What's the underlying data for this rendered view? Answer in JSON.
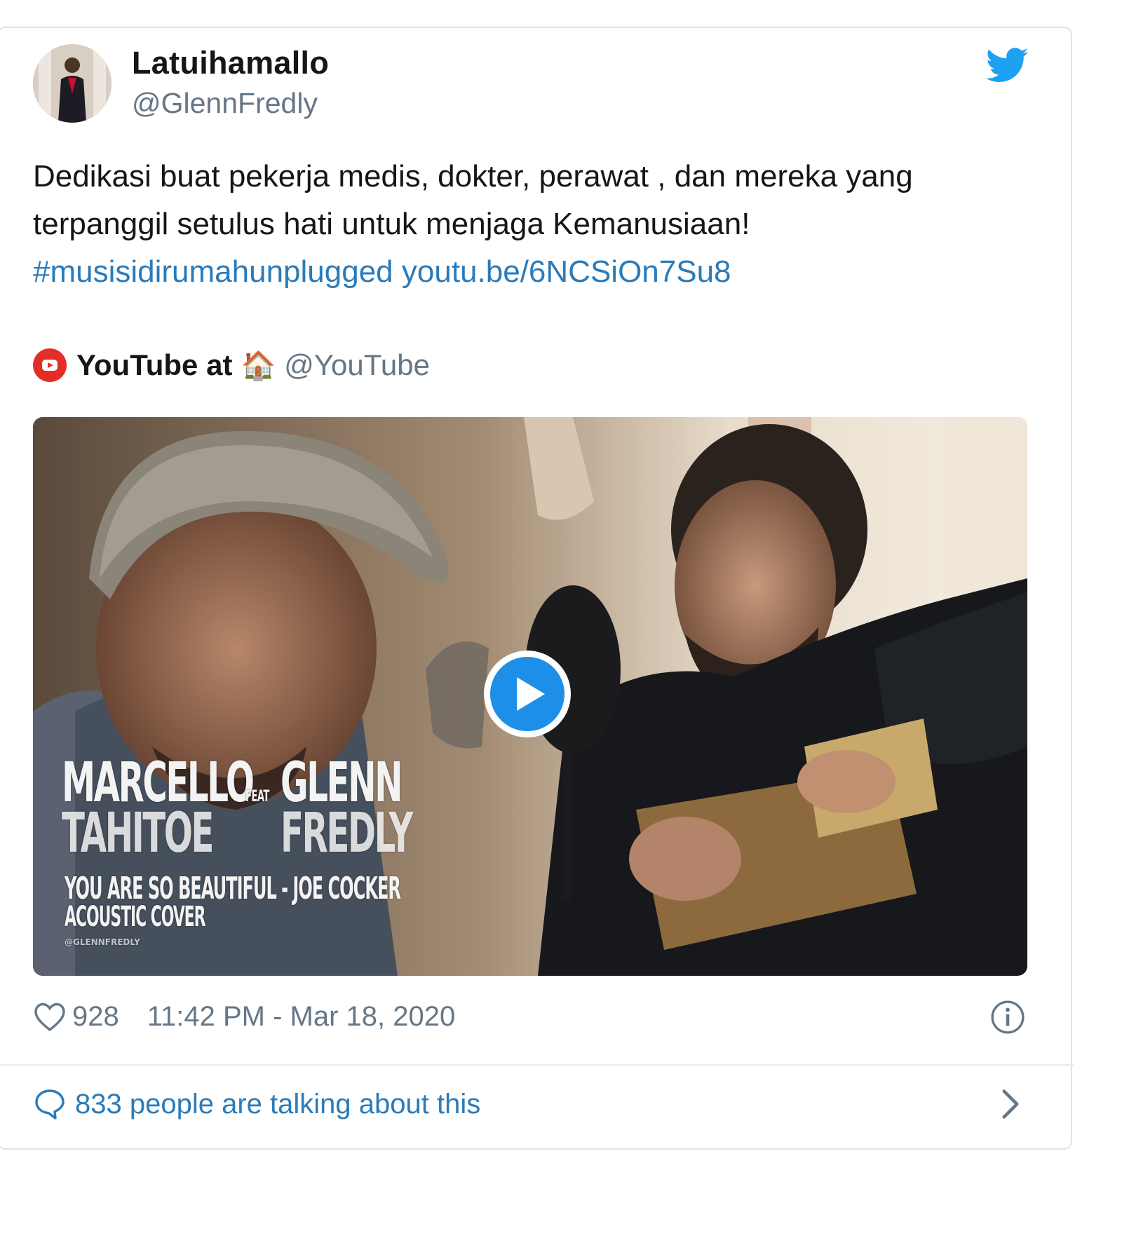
{
  "author": {
    "display_name": "Latuihamallo",
    "handle": "@GlennFredly"
  },
  "tweet": {
    "line1": "Dedikasi buat pekerja medis, dokter, perawat , dan mereka yang",
    "line2": "terpanggil setulus hati untuk menjaga Kemanusiaan!",
    "hashtag": "#musisidirumahunplugged",
    "link": "youtu.be/6NCSiOn7Su8"
  },
  "source": {
    "name": "YouTube at",
    "emoji": "🏠",
    "handle": "@YouTube"
  },
  "media": {
    "overlay": {
      "name1": "MARCELLO",
      "feat": "FEAT",
      "name2": "GLENN",
      "name1b": "TAHITOE",
      "name2b": "FREDLY",
      "song": "YOU ARE SO BEAUTIFUL - JOE COCKER",
      "subtitle": "ACOUSTIC COVER",
      "credit": "@GLENNFREDLY"
    }
  },
  "meta": {
    "likes": "928",
    "timestamp": "11:42 PM - Mar 18, 2020"
  },
  "footer": {
    "talking": "833 people are talking about this"
  },
  "colors": {
    "link": "#2b7bb9",
    "twitter_blue": "#1da1f2",
    "youtube_red": "#e52d27",
    "muted": "#657786"
  },
  "icons": [
    "twitter-bird-icon",
    "youtube-icon",
    "house-emoji",
    "play-icon",
    "heart-icon",
    "info-icon",
    "speech-bubble-icon",
    "chevron-right-icon"
  ]
}
